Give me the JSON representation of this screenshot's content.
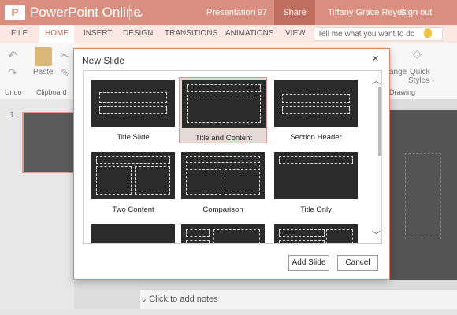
{
  "app": {
    "icon_letter": "P",
    "name": "PowerPoint Online",
    "document": "Presentation 97",
    "share": "Share",
    "user": "Tiffany Grace Reyes",
    "signout": "Sign out"
  },
  "tabs": [
    "FILE",
    "HOME",
    "INSERT",
    "DESIGN",
    "TRANSITIONS",
    "ANIMATIONS",
    "VIEW"
  ],
  "active_tab": "HOME",
  "tellme_placeholder": "Tell me what you want to do",
  "ribbon": {
    "undo_label": "Undo",
    "paste_label": "Paste",
    "clipboard_label": "Clipboard",
    "arrange_label": "ange",
    "quick_styles_label": "Quick",
    "styles_label": "Styles -",
    "drawing_label": "Drawing"
  },
  "thumbs": {
    "slide_number": "1"
  },
  "notes_placeholder": "Click to add notes",
  "dialog": {
    "title": "New Slide",
    "close_glyph": "×",
    "layouts": [
      "Title Slide",
      "Title and Content",
      "Section Header",
      "Two Content",
      "Comparison",
      "Title Only"
    ],
    "selected": "Title and Content",
    "add_button": "Add Slide",
    "cancel_button": "Cancel"
  },
  "colors": {
    "accent": "#d88f80",
    "share": "#bf6e60",
    "active_tab_text": "#c8604a"
  }
}
